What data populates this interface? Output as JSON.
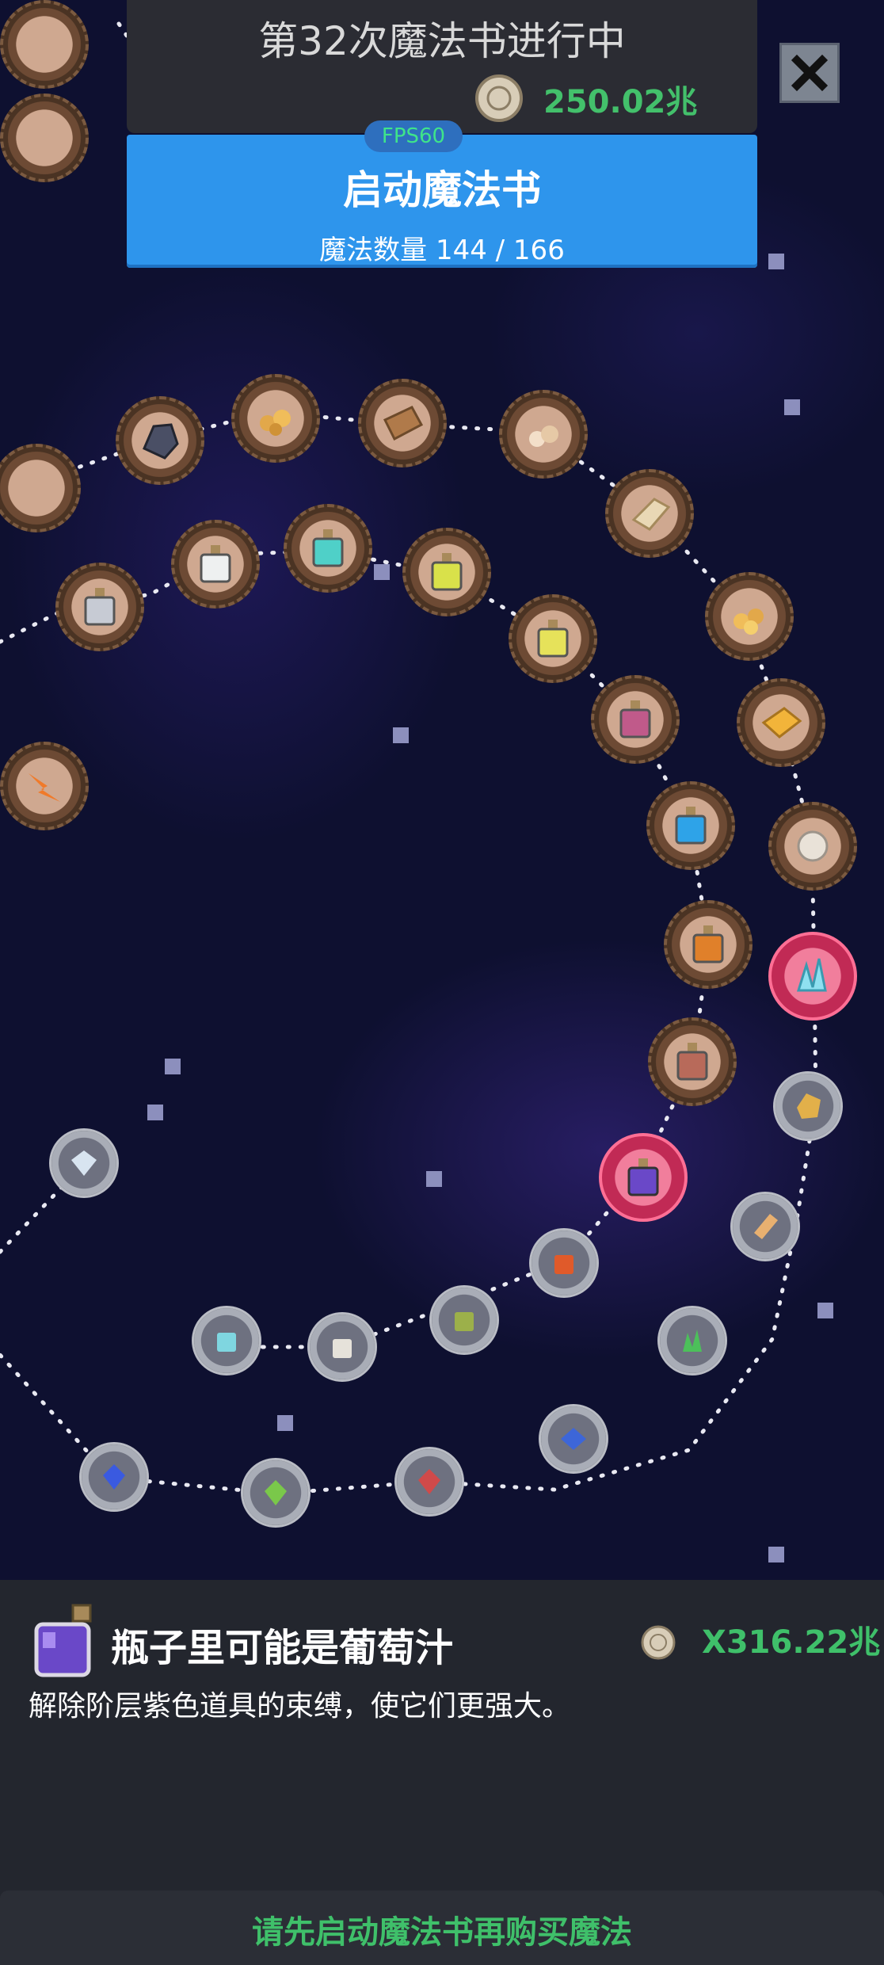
{
  "header": {
    "title": "第32次魔法书进行中",
    "currency": "250.02兆",
    "fps": "FPS60",
    "coin_icon": "coin-icon"
  },
  "start_button": {
    "label": "启动魔法书",
    "magic_count": "魔法数量 144 / 166"
  },
  "close_button": {
    "icon": "close-icon"
  },
  "selected_item": {
    "name": "瓶子里可能是葡萄汁",
    "description": "解除阶层紫色道具的束缚，使它们更强大。",
    "price": "X316.22兆",
    "icon": "purple-potion-icon"
  },
  "buy_bar": {
    "label": "请先启动魔法书再购买魔法"
  },
  "colors": {
    "accent_blue": "#2e95ec",
    "price_green": "#3fc06a",
    "active_node": "#c12a55"
  }
}
